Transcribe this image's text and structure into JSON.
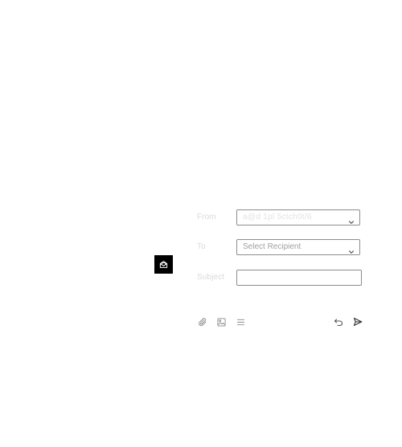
{
  "launcher": {
    "icon": "envelope-open-icon"
  },
  "compose": {
    "from": {
      "label": "From",
      "value": "a@d 1pl 5ctch0t/6"
    },
    "to": {
      "label": "To",
      "placeholder": "Select Recipient"
    },
    "subject": {
      "label": "Subject",
      "value": ""
    }
  },
  "toolbar": {
    "items": [
      {
        "icon": "paperclip-icon"
      },
      {
        "icon": "image-icon"
      },
      {
        "icon": "list-icon"
      },
      {
        "icon": "undo-icon"
      },
      {
        "icon": "send-icon"
      }
    ]
  },
  "colors": {
    "launcher_bg": "#000000",
    "field_border": "#8c8c8c",
    "label_text": "#d9d9d9",
    "placeholder_text": "#a0a0a0",
    "icon_stroke": "#8a8a8a",
    "send_stroke": "#333333"
  }
}
